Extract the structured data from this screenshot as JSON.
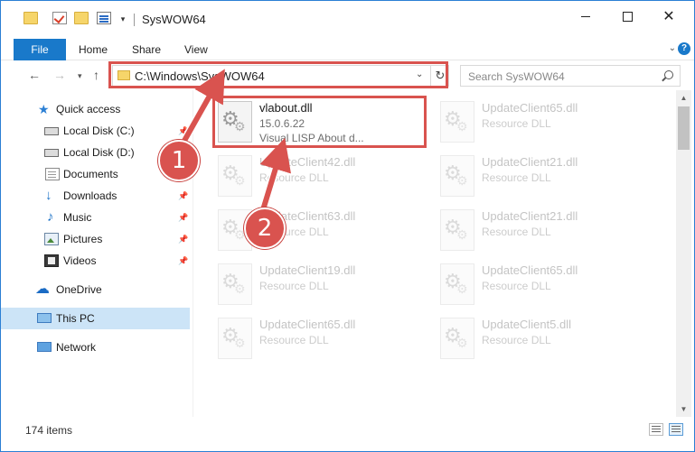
{
  "window": {
    "title": "SysWOW64"
  },
  "ribbon": {
    "tabs": [
      "File",
      "Home",
      "Share",
      "View"
    ]
  },
  "nav": {
    "address": "C:\\Windows\\SysWOW64",
    "search_placeholder": "Search SysWOW64"
  },
  "sidebar": {
    "items": [
      {
        "label": "Quick access",
        "icon": "quick-access-star-icon",
        "pinned": false
      },
      {
        "label": "Local Disk (C:)",
        "icon": "disk-icon",
        "pinned": true
      },
      {
        "label": "Local Disk (D:)",
        "icon": "disk-icon",
        "pinned": false
      },
      {
        "label": "Documents",
        "icon": "documents-icon",
        "pinned": false
      },
      {
        "label": "Downloads",
        "icon": "downloads-icon",
        "pinned": true
      },
      {
        "label": "Music",
        "icon": "music-icon",
        "pinned": true
      },
      {
        "label": "Pictures",
        "icon": "pictures-icon",
        "pinned": true
      },
      {
        "label": "Videos",
        "icon": "videos-icon",
        "pinned": true
      },
      {
        "label": "OneDrive",
        "icon": "onedrive-icon",
        "pinned": false
      },
      {
        "label": "This PC",
        "icon": "this-pc-icon",
        "pinned": false,
        "selected": true
      },
      {
        "label": "Network",
        "icon": "network-icon",
        "pinned": false
      }
    ]
  },
  "files": [
    {
      "name": "vlabout.dll",
      "line2": "15.0.6.22",
      "line3": "Visual LISP About d...",
      "highlighted": true
    },
    {
      "name": "UpdateClient65.dll",
      "line2": "Resource DLL"
    },
    {
      "name": "UpdateClient42.dll",
      "line2": "Resource DLL"
    },
    {
      "name": "UpdateClient21.dll",
      "line2": "Resource DLL"
    },
    {
      "name": "UpdateClient63.dll",
      "line2": "Resource DLL"
    },
    {
      "name": "UpdateClient21.dll",
      "line2": "Resource DLL"
    },
    {
      "name": "UpdateClient19.dll",
      "line2": "Resource DLL"
    },
    {
      "name": "UpdateClient65.dll",
      "line2": "Resource DLL"
    },
    {
      "name": "UpdateClient65.dll",
      "line2": "Resource DLL"
    },
    {
      "name": "UpdateClient5.dll",
      "line2": "Resource DLL"
    }
  ],
  "status": {
    "item_count": "174 items"
  },
  "callouts": [
    "1",
    "2"
  ],
  "colors": {
    "accent": "#1979ca",
    "highlight": "#d9534f",
    "selected": "#cce4f7"
  }
}
